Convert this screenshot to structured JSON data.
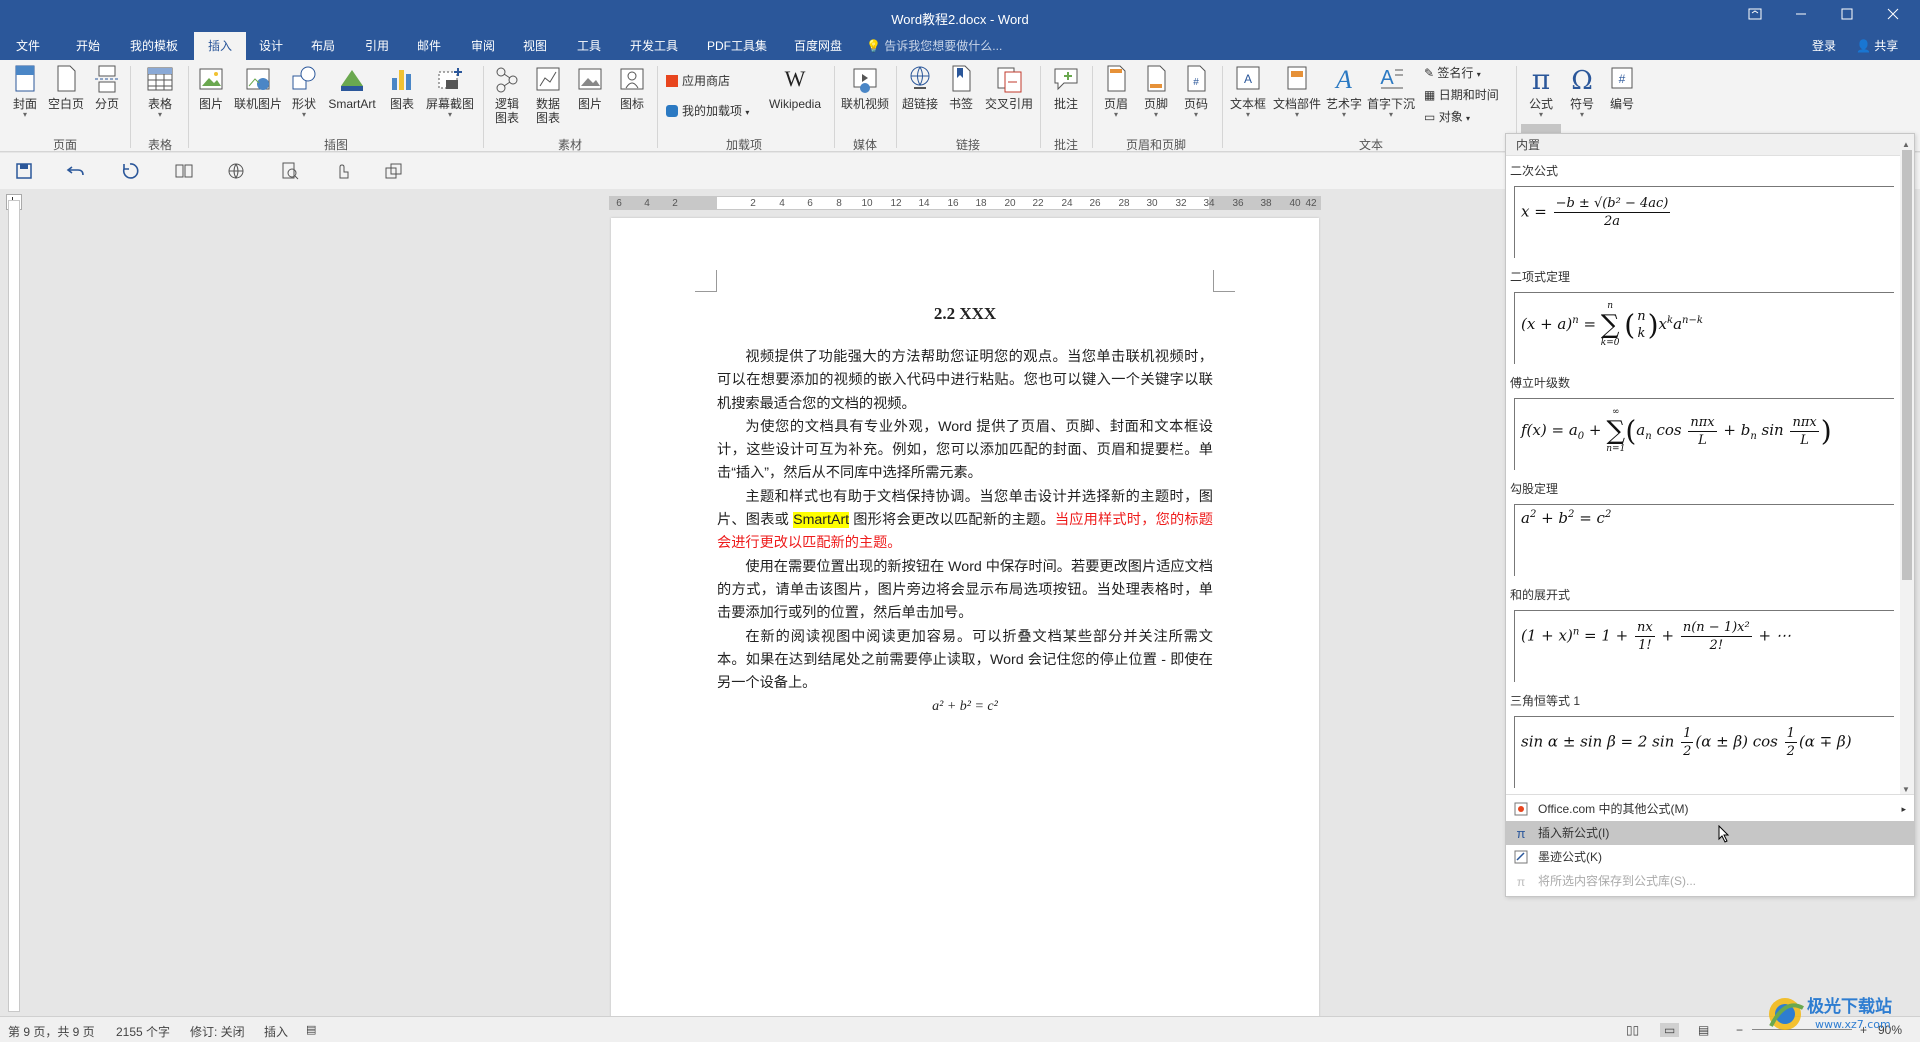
{
  "window": {
    "title": "Word教程2.docx - Word",
    "ribbon_display_icon": "ribbon-display-icon",
    "minimize_icon": "minimize-icon",
    "maximize_icon": "maximize-icon",
    "close_icon": "close-icon"
  },
  "tabs": [
    "文件",
    "开始",
    "我的模板",
    "插入",
    "设计",
    "布局",
    "引用",
    "邮件",
    "审阅",
    "视图",
    "工具",
    "开发工具",
    "PDF工具集",
    "百度网盘"
  ],
  "active_tab": "插入",
  "tell_me": "告诉我您想要做什么...",
  "login": "登录",
  "share": "共享",
  "ribbon": {
    "buttons": {
      "cover": "封面",
      "blank_page": "空白页",
      "page_break": "分页",
      "table": "表格",
      "picture": "图片",
      "online_picture": "联机图片",
      "shapes": "形状",
      "smartart": "SmartArt",
      "chart": "图表",
      "screenshot": "屏幕截图",
      "logic_chart_1": "逻辑",
      "logic_chart_2": "图表",
      "data_chart_1": "数据",
      "data_chart_2": "图表",
      "picture2": "图片",
      "icon": "图标",
      "app_store": "应用商店",
      "my_addins": "我的加载项",
      "wikipedia": "Wikipedia",
      "online_video": "联机视频",
      "hyperlink": "超链接",
      "bookmark": "书签",
      "cross_reference": "交叉引用",
      "comment": "批注",
      "header": "页眉",
      "footer": "页脚",
      "page_number": "页码",
      "text_box": "文本框",
      "quick_parts": "文档部件",
      "wordart": "艺术字",
      "drop_cap": "首字下沉",
      "signature_line": "签名行",
      "date_time": "日期和时间",
      "object": "对象",
      "equation": "公式",
      "symbol": "符号",
      "number": "编号"
    },
    "groups": {
      "pages": "页面",
      "tables": "表格",
      "illustrations": "插图",
      "materials": "素材",
      "addins": "加载项",
      "media": "媒体",
      "links": "链接",
      "comments": "批注",
      "header_footer": "页眉和页脚",
      "text": "文本"
    }
  },
  "ruler_numbers": [
    "6",
    "4",
    "2",
    "2",
    "4",
    "6",
    "8",
    "10",
    "12",
    "14",
    "16",
    "18",
    "20",
    "22",
    "24",
    "26",
    "28",
    "30",
    "32",
    "34",
    "36",
    "38",
    "40",
    "42"
  ],
  "document": {
    "heading": "2.2 XXX",
    "p1": "视频提供了功能强大的方法帮助您证明您的观点。当您单击联机视频时，可以在想要添加的视频的嵌入代码中进行粘贴。您也可以键入一个关键字以联机搜索最适合您的文档的视频。",
    "p2": "为使您的文档具有专业外观，Word 提供了页眉、页脚、封面和文本框设计，这些设计可互为补充。例如，您可以添加匹配的封面、页眉和提要栏。单击“插入”，然后从不同库中选择所需元素。",
    "p3_a": "主题和样式也有助于文档保持协调。当您单击设计并选择新的主题时，图片、图表或 ",
    "p3_hl": "SmartArt",
    "p3_b": " 图形将会更改以匹配新的主题。",
    "p3_red": "当应用样式时，您的标题会进行更改以匹配新的主题。",
    "p4": "使用在需要位置出现的新按钮在 Word 中保存时间。若要更改图片适应文档的方式，请单击该图片，图片旁边将会显示布局选项按钮。当处理表格时，单击要添加行或列的位置，然后单击加号。",
    "p5": "在新的阅读视图中阅读更加容易。可以折叠文档某些部分并关注所需文本。如果在达到结尾处之前需要停止读取，Word 会记住您的停止位置 - 即使在另一个设备上。",
    "equation": "a² + b² = c²"
  },
  "gallery": {
    "header": "内置",
    "items": [
      {
        "name": "二次公式"
      },
      {
        "name": "二项式定理"
      },
      {
        "name": "傅立叶级数"
      },
      {
        "name": "勾股定理"
      },
      {
        "name": "和的展开式"
      },
      {
        "name": "三角恒等式 1"
      }
    ],
    "menu": {
      "more_office": "Office.com 中的其他公式(M)",
      "insert_new": "插入新公式(I)",
      "ink_equation": "墨迹公式(K)",
      "save_selection": "将所选内容保存到公式库(S)..."
    }
  },
  "status": {
    "page": "第 9 页，共 9 页",
    "words": "2155 个字",
    "track": "修订: 关闭",
    "mode": "插入",
    "zoom": "90%"
  },
  "colors": {
    "brand": "#2b579a",
    "highlight": "#ffff00",
    "red_text": "#ee1c1c"
  }
}
